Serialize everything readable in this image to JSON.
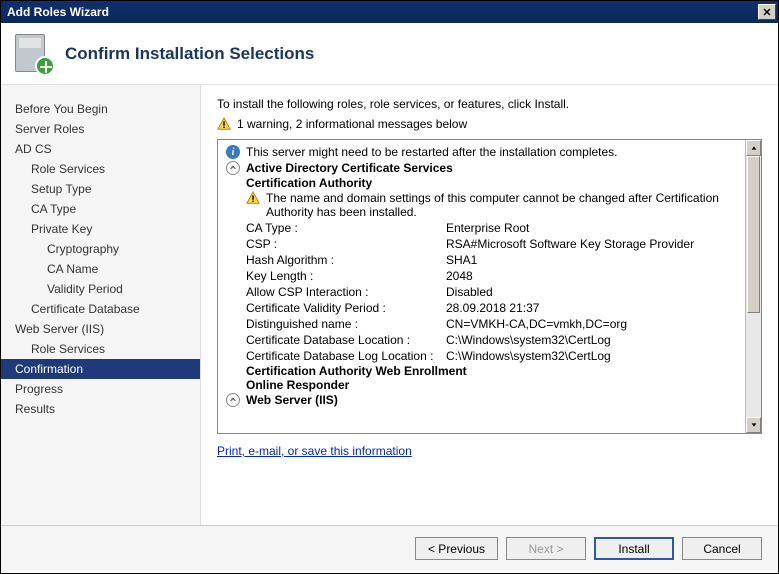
{
  "window": {
    "title": "Add Roles Wizard"
  },
  "header": {
    "title": "Confirm Installation Selections"
  },
  "sidebar": {
    "items": [
      {
        "label": "Before You Begin",
        "indent": 0
      },
      {
        "label": "Server Roles",
        "indent": 0
      },
      {
        "label": "AD CS",
        "indent": 0
      },
      {
        "label": "Role Services",
        "indent": 1
      },
      {
        "label": "Setup Type",
        "indent": 1
      },
      {
        "label": "CA Type",
        "indent": 1
      },
      {
        "label": "Private Key",
        "indent": 1
      },
      {
        "label": "Cryptography",
        "indent": 2
      },
      {
        "label": "CA Name",
        "indent": 2
      },
      {
        "label": "Validity Period",
        "indent": 2
      },
      {
        "label": "Certificate Database",
        "indent": 1
      },
      {
        "label": "Web Server (IIS)",
        "indent": 0
      },
      {
        "label": "Role Services",
        "indent": 1
      },
      {
        "label": "Confirmation",
        "indent": 0,
        "active": true
      },
      {
        "label": "Progress",
        "indent": 0
      },
      {
        "label": "Results",
        "indent": 0
      }
    ]
  },
  "main": {
    "intro": "To install the following roles, role services, or features, click Install.",
    "warning_summary": "1 warning, 2 informational messages below",
    "restart_msg": "This server might need to be restarted after the installation completes.",
    "adcs_heading": "Active Directory Certificate Services",
    "ca_heading": "Certification Authority",
    "ca_warning": "The name and domain settings of this computer cannot be changed after Certification Authority has been installed.",
    "kv": [
      {
        "k": "CA Type :",
        "v": "Enterprise Root"
      },
      {
        "k": "CSP :",
        "v": "RSA#Microsoft Software Key Storage Provider"
      },
      {
        "k": "Hash Algorithm :",
        "v": "SHA1"
      },
      {
        "k": "Key Length :",
        "v": "2048"
      },
      {
        "k": "Allow CSP Interaction :",
        "v": "Disabled"
      },
      {
        "k": "Certificate Validity Period :",
        "v": "28.09.2018 21:37"
      },
      {
        "k": "Distinguished name :",
        "v": "CN=VMKH-CA,DC=vmkh,DC=org"
      },
      {
        "k": "Certificate Database Location :",
        "v": "C:\\Windows\\system32\\CertLog"
      },
      {
        "k": "Certificate Database Log Location :",
        "v": "C:\\Windows\\system32\\CertLog"
      }
    ],
    "cawe_heading": "Certification Authority Web Enrollment",
    "or_heading": "Online Responder",
    "iis_heading": "Web Server (IIS)",
    "link": "Print, e-mail, or save this information"
  },
  "footer": {
    "previous": "< Previous",
    "next": "Next >",
    "install": "Install",
    "cancel": "Cancel"
  }
}
